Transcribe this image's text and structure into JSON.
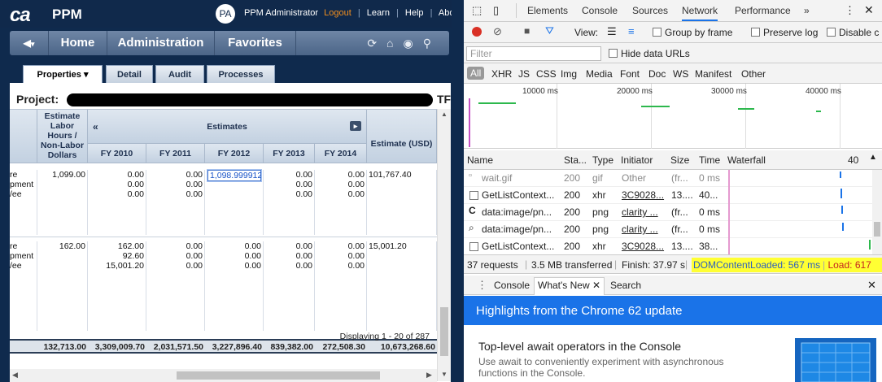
{
  "app": {
    "logo": "ca",
    "name": "PPM",
    "user_initials": "PA",
    "user_name": "PPM Administrator",
    "logout": "Logout",
    "learn": "Learn",
    "help": "Help",
    "about": "About"
  },
  "nav": {
    "home": "Home",
    "administration": "Administration",
    "favorites": "Favorites"
  },
  "tabs": [
    {
      "label": "Properties ▾",
      "active": true
    },
    {
      "label": "Detail"
    },
    {
      "label": "Audit"
    },
    {
      "label": "Processes"
    }
  ],
  "page": {
    "project_label": "Project:",
    "tf_label": "TF"
  },
  "grid": {
    "col_labor": "Estimate Labor Hours / Non-Labor Dollars",
    "col_estimates": "Estimates",
    "years": [
      "FY 2010",
      "FY 2011",
      "FY 2012",
      "FY 2013",
      "FY 2014"
    ],
    "col_estimate_usd": "Estimate (USD)",
    "rows": [
      {
        "type_lines": [
          "re",
          "pment",
          "/ee"
        ],
        "labor": "1,099.00",
        "fy": [
          [
            "0.00",
            "0.00",
            "0.00"
          ],
          [
            "0.00",
            "0.00",
            "0.00"
          ],
          [],
          [
            "0.00",
            "0.00",
            "0.00"
          ],
          [
            "0.00",
            "0.00",
            "0.00"
          ]
        ],
        "edit_value": "1,098.999912",
        "estimate": "101,767.40"
      },
      {
        "type_lines": [
          "re",
          "pment",
          "/ee"
        ],
        "labor": "162.00",
        "fy": [
          [
            "162.00",
            "92.60",
            "15,001.20"
          ],
          [
            "0.00",
            "0.00",
            "0.00"
          ],
          [
            "0.00",
            "0.00",
            "0.00"
          ],
          [
            "0.00",
            "0.00",
            "0.00"
          ],
          [
            "0.00",
            "0.00",
            "0.00"
          ]
        ],
        "estimate": "15,001.20"
      }
    ],
    "totals": [
      "132,713.00",
      "3,309,009.70",
      "2,031,571.50",
      "3,227,896.40",
      "839,382.00",
      "272,508.30",
      "10,673,268.60"
    ],
    "displaying": "Displaying 1 - 20 of 287"
  },
  "devtools": {
    "tabs": [
      "Elements",
      "Console",
      "Sources",
      "Network",
      "Performance",
      "»"
    ],
    "view_label": "View:",
    "group_by_frame": "Group by frame",
    "preserve_log": "Preserve log",
    "disable_cache": "Disable c",
    "filter_placeholder": "Filter",
    "hide_data_urls": "Hide data URLs",
    "types": [
      "All",
      "XHR",
      "JS",
      "CSS",
      "Img",
      "Media",
      "Font",
      "Doc",
      "WS",
      "Manifest",
      "Other"
    ],
    "ticks": [
      "10000 ms",
      "20000 ms",
      "30000 ms",
      "40000 ms"
    ],
    "columns": [
      "Name",
      "Sta...",
      "Type",
      "Initiator",
      "Size",
      "Time",
      "Waterfall",
      "40"
    ],
    "requests": [
      {
        "name": "wait.gif",
        "status": "200",
        "type": "gif",
        "initiator": "Other",
        "size": "(fr...",
        "time": "0 ms"
      },
      {
        "name": "GetListContext...",
        "status": "200",
        "type": "xhr",
        "initiator": "3C9028...",
        "size": "13....",
        "time": "40..."
      },
      {
        "name": "data:image/pn...",
        "status": "200",
        "type": "png",
        "initiator": "clarity ...",
        "size": "(fr...",
        "time": "0 ms"
      },
      {
        "name": "data:image/pn...",
        "status": "200",
        "type": "png",
        "initiator": "clarity ...",
        "size": "(fr...",
        "time": "0 ms"
      },
      {
        "name": "GetListContext...",
        "status": "200",
        "type": "xhr",
        "initiator": "3C9028...",
        "size": "13....",
        "time": "38..."
      }
    ],
    "summary_requests": "37 requests",
    "summary_transferred": "3.5 MB transferred",
    "summary_finish": "Finish: 37.97 s",
    "dom_content_loaded": "DOMContentLoaded: 567 ms",
    "load": "Load: 617",
    "drawer_tabs": [
      "Console",
      "What's New",
      "Search"
    ],
    "banner": "Highlights from the Chrome 62 update",
    "whatsnew_title": "Top-level await operators in the Console",
    "whatsnew_desc": "Use await to conveniently experiment with asynchronous functions in the Console."
  }
}
